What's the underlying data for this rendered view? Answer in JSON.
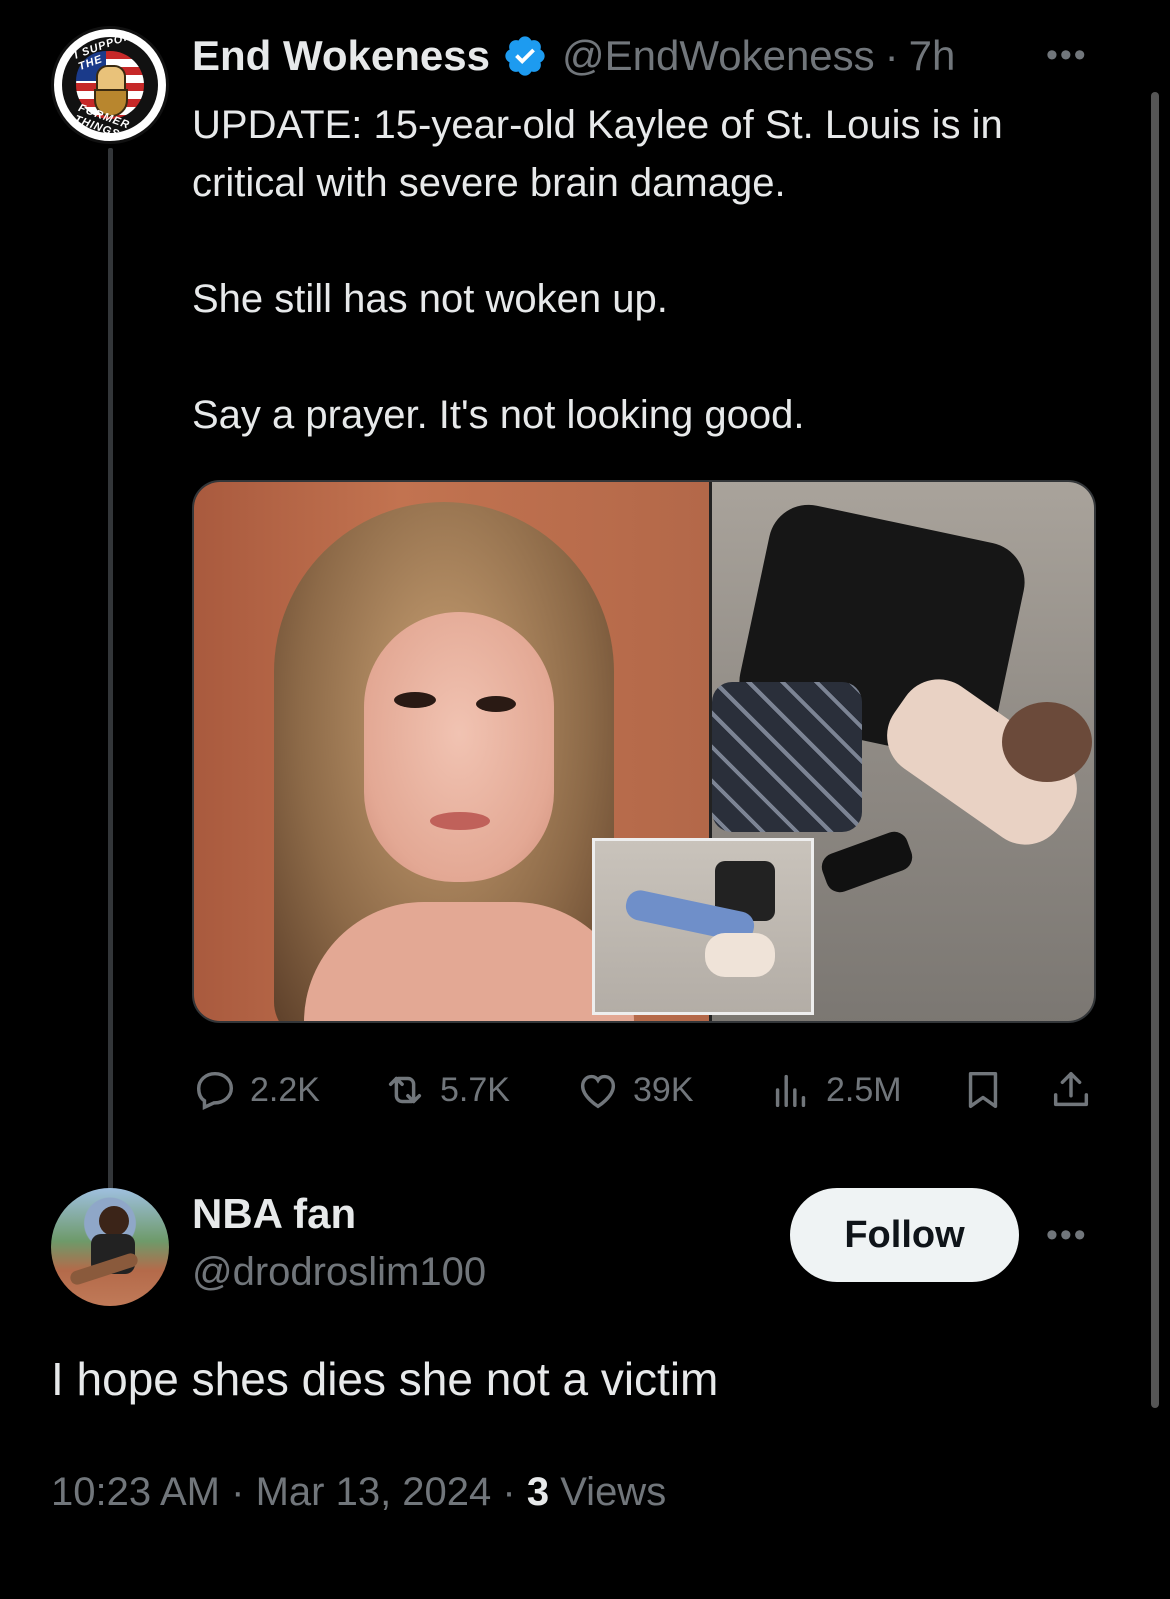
{
  "tweet": {
    "avatar_text_top": "I SUPPORT THE",
    "avatar_text_bottom": "FORMER THINGS",
    "author_name": "End Wokeness",
    "handle": "@EndWokeness",
    "separator": "·",
    "time": "7h",
    "text_p1": "UPDATE: 15-year-old Kaylee of St. Louis is in critical with severe brain damage.",
    "text_p2": "She still has not woken up.",
    "text_p3": "Say a prayer. It's not looking good.",
    "stats": {
      "replies": "2.2K",
      "retweets": "5.7K",
      "likes": "39K",
      "views": "2.5M"
    }
  },
  "reply": {
    "author_name": "NBA fan",
    "handle": "@drodroslim100",
    "follow_label": "Follow",
    "text": "I hope shes dies she not a victim",
    "time": "10:23 AM",
    "date": "Mar 13, 2024",
    "views_count": "3",
    "views_label": "Views"
  },
  "colors": {
    "background": "#000000",
    "text": "#e7e9ea",
    "muted": "#71767b",
    "verified": "#1d9bf0"
  },
  "icons": [
    "verified-badge-icon",
    "more-icon",
    "reply-icon",
    "retweet-icon",
    "like-icon",
    "views-icon",
    "bookmark-icon",
    "share-icon"
  ]
}
